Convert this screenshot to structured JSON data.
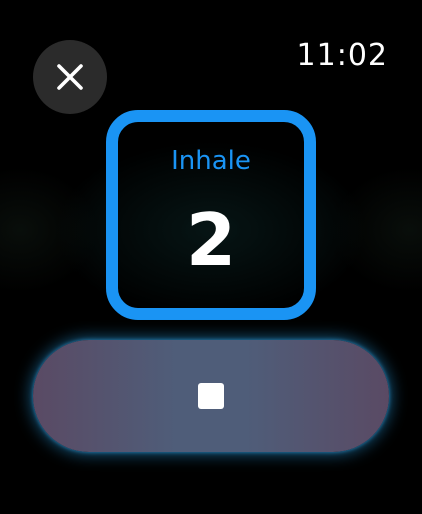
{
  "status_bar": {
    "time": "11:02"
  },
  "session": {
    "phase_label": "Inhale",
    "count": "2"
  },
  "controls": {
    "close_icon": "close-icon",
    "stop_icon": "stop-icon"
  },
  "colors": {
    "accent": "#1a94f4",
    "background": "#000000",
    "close_button_bg": "#2b2b2b",
    "stop_button_bg": "#4f5d79",
    "stop_button_glow": "#28a0e6"
  }
}
